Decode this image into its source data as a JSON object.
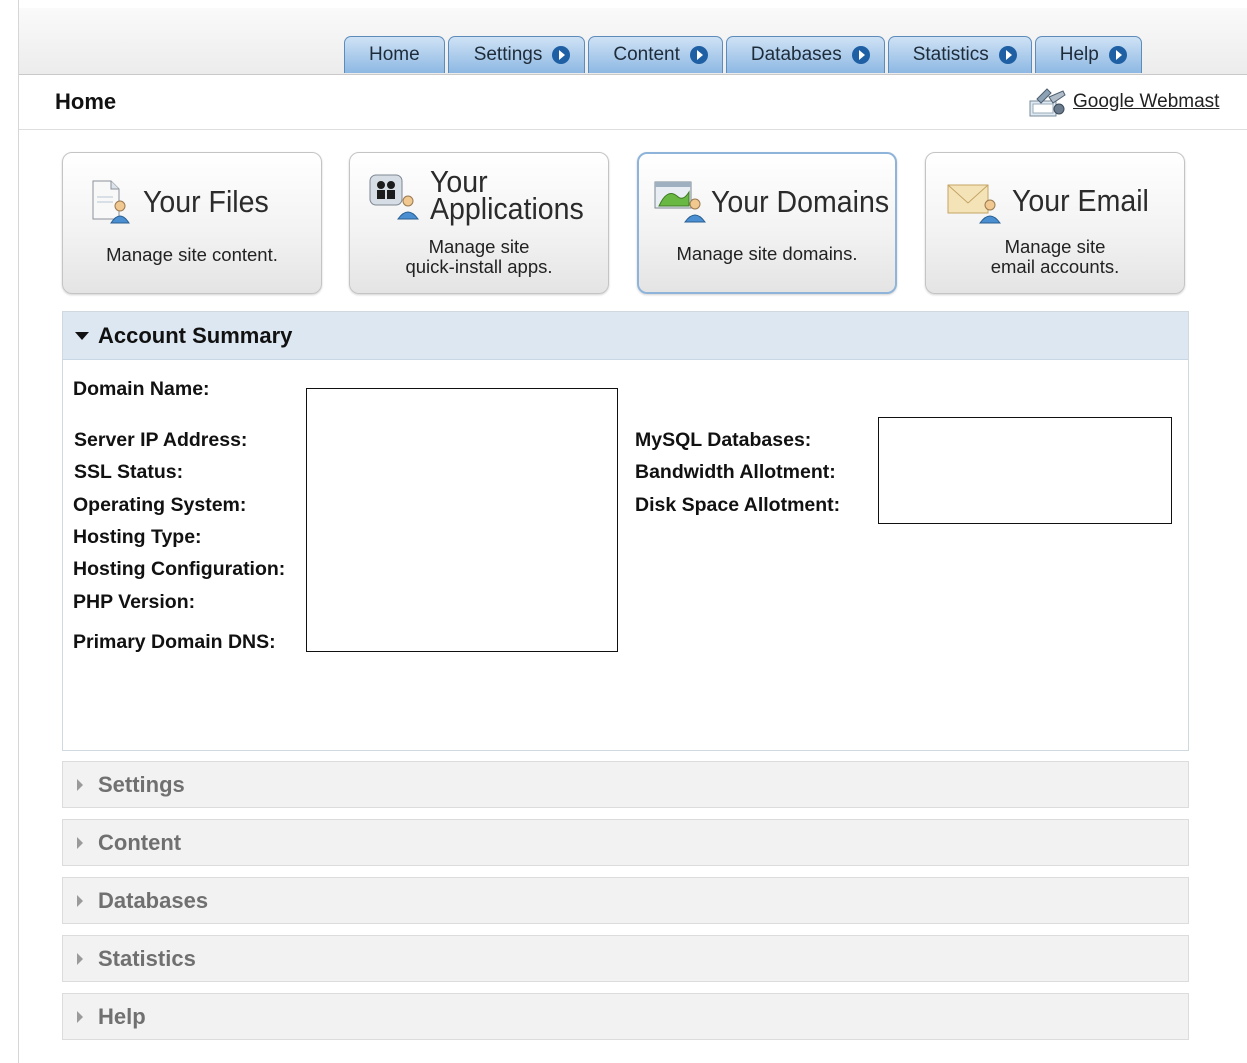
{
  "tabs": [
    {
      "label": "Home",
      "has_arrow": false
    },
    {
      "label": "Settings",
      "has_arrow": true
    },
    {
      "label": "Content",
      "has_arrow": true
    },
    {
      "label": "Databases",
      "has_arrow": true
    },
    {
      "label": "Statistics",
      "has_arrow": true
    },
    {
      "label": "Help",
      "has_arrow": true
    }
  ],
  "header": {
    "title": "Home",
    "webmaster_link": "Google Webmast"
  },
  "cards": [
    {
      "title_line1": "Your Files",
      "title_line2": "",
      "desc": "Manage site content.",
      "icon": "files-icon",
      "selected": false
    },
    {
      "title_line1": "Your",
      "title_line2": "Applications",
      "desc": "Manage site\nquick-install apps.",
      "icon": "applications-icon",
      "selected": false
    },
    {
      "title_line1": "Your Domains",
      "title_line2": "",
      "desc": "Manage site domains.",
      "icon": "domains-icon",
      "selected": true
    },
    {
      "title_line1": "Your Email",
      "title_line2": "",
      "desc": "Manage site\nemail accounts.",
      "icon": "email-icon",
      "selected": false
    }
  ],
  "account_summary": {
    "title": "Account Summary",
    "left_labels": [
      "Domain Name:",
      "Server IP Address:",
      "SSL Status:",
      "Operating System:",
      "Hosting Type:",
      "Hosting Configuration:",
      "PHP Version:",
      "Primary Domain DNS:"
    ],
    "right_labels": [
      "MySQL Databases:",
      "Bandwidth Allotment:",
      "Disk Space Allotment:"
    ]
  },
  "sections": [
    "Settings",
    "Content",
    "Databases",
    "Statistics",
    "Help"
  ],
  "colors": {
    "tab_gradient_top": "#cfe2f5",
    "tab_gradient_bottom": "#8db8e3",
    "tab_arrow": "#1f5fa4",
    "summary_header_bg": "#dce7f2",
    "section_bg": "#f2f2f2",
    "selected_card_border": "#8fb4da"
  }
}
